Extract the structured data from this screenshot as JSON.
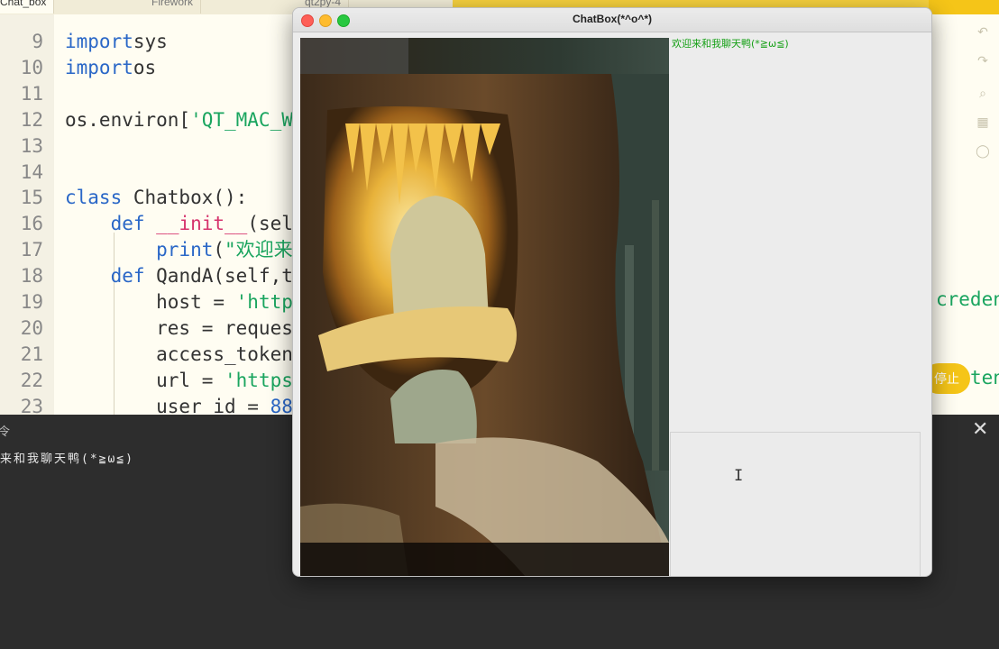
{
  "editor": {
    "tabs": [
      "Chat_box",
      "Firework",
      "qt2py-4"
    ],
    "lines": [
      {
        "n": "9",
        "tokens": [
          [
            "kw",
            "import"
          ],
          [
            "",
            "sys"
          ]
        ]
      },
      {
        "n": "10",
        "tokens": [
          [
            "kw",
            "import"
          ],
          [
            "",
            "os"
          ]
        ]
      },
      {
        "n": "11",
        "tokens": []
      },
      {
        "n": "12",
        "tokens": [
          [
            "",
            "os.environ["
          ],
          [
            "str",
            "'QT_MAC_W"
          ]
        ]
      },
      {
        "n": "13",
        "tokens": []
      },
      {
        "n": "14",
        "tokens": []
      },
      {
        "n": "15",
        "tokens": [
          [
            "kw",
            "class"
          ],
          [
            "",
            " Chatbox():"
          ]
        ]
      },
      {
        "n": "16",
        "tokens": [
          [
            "",
            "    "
          ],
          [
            "kw",
            "def"
          ],
          [
            "",
            " "
          ],
          [
            "fn",
            "__init__"
          ],
          [
            "",
            "(sel"
          ]
        ]
      },
      {
        "n": "17",
        "tokens": [
          [
            "",
            "        "
          ],
          [
            "kw",
            "print"
          ],
          [
            "",
            "("
          ],
          [
            "str",
            "\"欢迎来"
          ]
        ]
      },
      {
        "n": "18",
        "tokens": [
          [
            "",
            "    "
          ],
          [
            "kw",
            "def"
          ],
          [
            "",
            " QandA(self,t"
          ]
        ]
      },
      {
        "n": "19",
        "tokens": [
          [
            "",
            "        host = "
          ],
          [
            "str",
            "'http"
          ]
        ]
      },
      {
        "n": "20",
        "tokens": [
          [
            "",
            "        res = reques"
          ]
        ]
      },
      {
        "n": "21",
        "tokens": [
          [
            "",
            "        access_token"
          ]
        ]
      },
      {
        "n": "22",
        "tokens": [
          [
            "",
            "        url = "
          ],
          [
            "str",
            "'https"
          ]
        ]
      },
      {
        "n": "23",
        "tokens": [
          [
            "",
            "        user_id = "
          ],
          [
            "kw",
            "88"
          ]
        ]
      }
    ],
    "right_overflow_19": "credent",
    "right_overflow_22": "tens",
    "stop_label": "停止"
  },
  "terminal": {
    "label": "令",
    "output": "来和我聊天鸭(*≧ω≦)",
    "close_glyph": "✕"
  },
  "chat_window": {
    "title": "ChatBox(*^o^*)",
    "welcome_message": "欢迎来和我聊天鸭(*≧ω≦)",
    "image_alt": "snowy hollow tree trunk glowing cave",
    "cursor_glyph": "I"
  },
  "icons": {
    "editor_side": [
      "undo-icon",
      "redo-icon",
      "search-icon",
      "grid-icon",
      "comment-icon"
    ]
  },
  "colors": {
    "keyword": "#2a67c7",
    "string": "#1aa55f",
    "dunder": "#d6336c",
    "accent": "#f5c518",
    "welcome_text": "#16a016"
  }
}
